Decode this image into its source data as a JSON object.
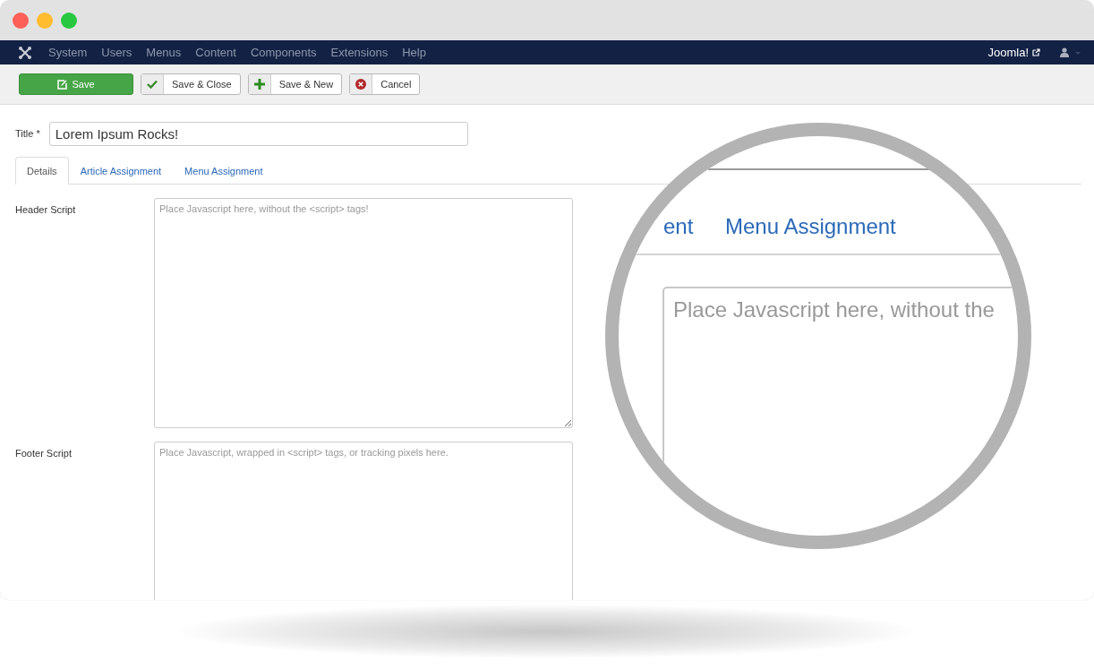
{
  "window": {
    "traffic_lights": [
      {
        "color": "#fe5f57"
      },
      {
        "color": "#febc2e"
      },
      {
        "color": "#28c840"
      }
    ]
  },
  "nav": {
    "menu": [
      "System",
      "Users",
      "Menus",
      "Content",
      "Components",
      "Extensions",
      "Help"
    ],
    "site_link": "Joomla!"
  },
  "toolbar": [
    {
      "label": "Save",
      "kind": "primary"
    },
    {
      "label": "Save & Close",
      "kind": "check"
    },
    {
      "label": "Save & New",
      "kind": "plus"
    },
    {
      "label": "Cancel",
      "kind": "cancel"
    }
  ],
  "title_field": {
    "label": "Title *",
    "value": "Lorem Ipsum Rocks!"
  },
  "tabs": [
    {
      "label": "Details",
      "selected": true
    },
    {
      "label": "Article Assignment",
      "selected": false
    },
    {
      "label": "Menu Assignment",
      "selected": false
    }
  ],
  "fields": [
    {
      "label": "Header Script",
      "placeholder": "Place Javascript here, without the <script> tags!"
    },
    {
      "label": "Footer Script",
      "placeholder": "Place Javascript, wrapped in <script> tags, or tracking pixels here."
    }
  ],
  "magnifier": {
    "tab_fragment": "ent",
    "tab": "Menu Assignment",
    "placeholder": "Place Javascript here, without the"
  }
}
